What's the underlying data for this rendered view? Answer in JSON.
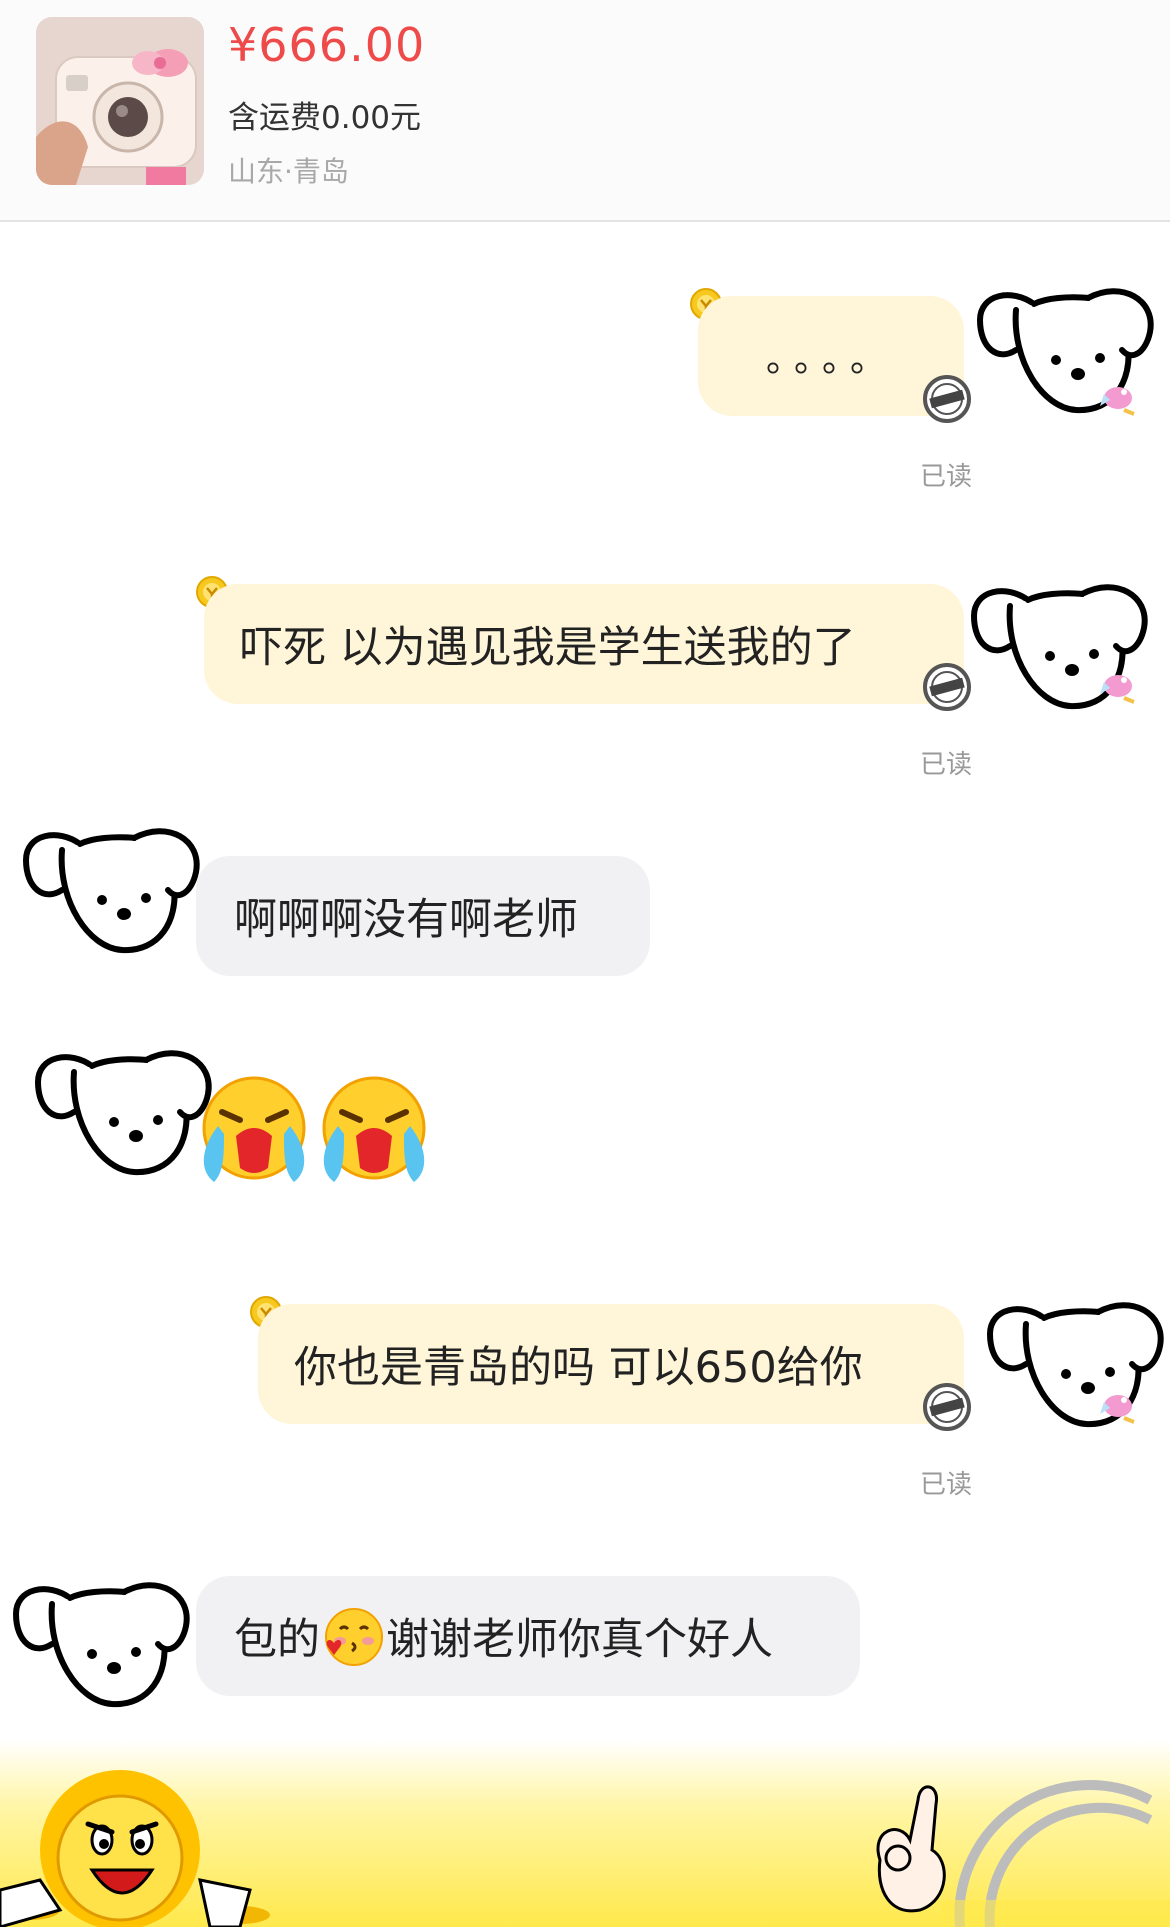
{
  "product": {
    "price": "¥666.00",
    "shipping": "含运费0.00元",
    "location": "山东·青岛"
  },
  "messages": [
    {
      "side": "sent",
      "text": "。。。。",
      "status": "已读"
    },
    {
      "side": "sent",
      "text": "吓死 以为遇见我是学生送我的了",
      "status": "已读"
    },
    {
      "side": "received",
      "text": "啊啊啊没有啊老师"
    },
    {
      "side": "received",
      "emoji": "crying-face-emoji",
      "count": 2
    },
    {
      "side": "sent",
      "text": "你也是青岛的吗 可以650给你",
      "status": "已读"
    },
    {
      "side": "received",
      "text_before": "包的",
      "emoji": "kissing-heart-face-emoji",
      "text_after": "谢谢老师你真个好人"
    }
  ],
  "icons": {
    "avatar": "puppy-doodle-avatar",
    "badge": "gold-coin-badge",
    "stamp": "sold-stamp",
    "bird": "pink-bird-sticker"
  },
  "colors": {
    "price": "#ef4a4a",
    "sent_bubble": "#fff5d8",
    "received_bubble": "#f1f1f3",
    "banner": "#ffe94c"
  }
}
